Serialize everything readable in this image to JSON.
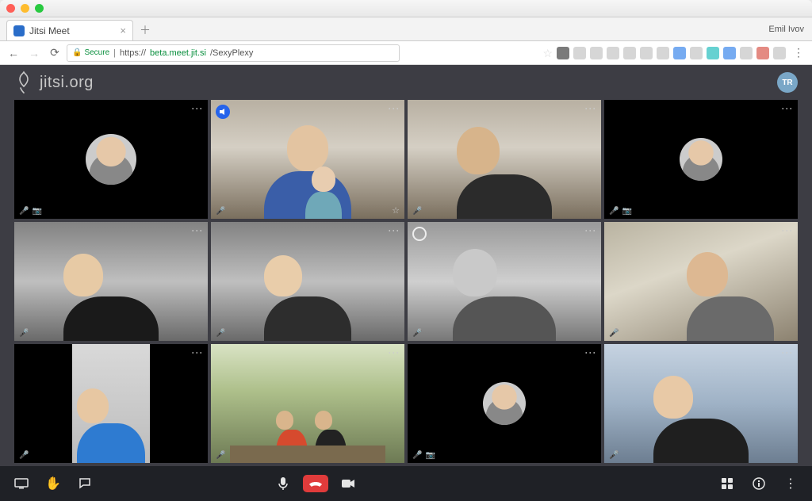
{
  "browser": {
    "tab_title": "Jitsi Meet",
    "profile_name": "Emil Ivov",
    "secure_label": "Secure",
    "url_scheme": "https://",
    "url_host": "beta.meet.jit.si",
    "url_path": "/SexyPlexy"
  },
  "header": {
    "logo_text": "jitsi.org",
    "user_initials": "TR"
  },
  "participants": [
    {
      "id": 0,
      "type": "avatar",
      "bg": "black"
    },
    {
      "id": 1,
      "type": "video",
      "bg": "room",
      "active": true,
      "speaking": true,
      "pinned": true
    },
    {
      "id": 2,
      "type": "video",
      "bg": "room"
    },
    {
      "id": 3,
      "type": "avatar",
      "bg": "black"
    },
    {
      "id": 4,
      "type": "video",
      "bg": "office"
    },
    {
      "id": 5,
      "type": "video",
      "bg": "office"
    },
    {
      "id": 6,
      "type": "video",
      "bg": "bw",
      "dominant": true
    },
    {
      "id": 7,
      "type": "video",
      "bg": "office2"
    },
    {
      "id": 8,
      "type": "video",
      "bg": "narrow"
    },
    {
      "id": 9,
      "type": "video",
      "bg": "green"
    },
    {
      "id": 10,
      "type": "avatar",
      "bg": "black",
      "small": true
    },
    {
      "id": 11,
      "type": "video",
      "bg": "blueroom"
    }
  ],
  "toolbar": {
    "screenshare": "screenshare",
    "raisehand": "raise-hand",
    "chat": "chat",
    "mic": "microphone",
    "hangup": "hang-up",
    "camera": "camera",
    "tileview": "tile-view",
    "info": "info",
    "more": "more"
  }
}
